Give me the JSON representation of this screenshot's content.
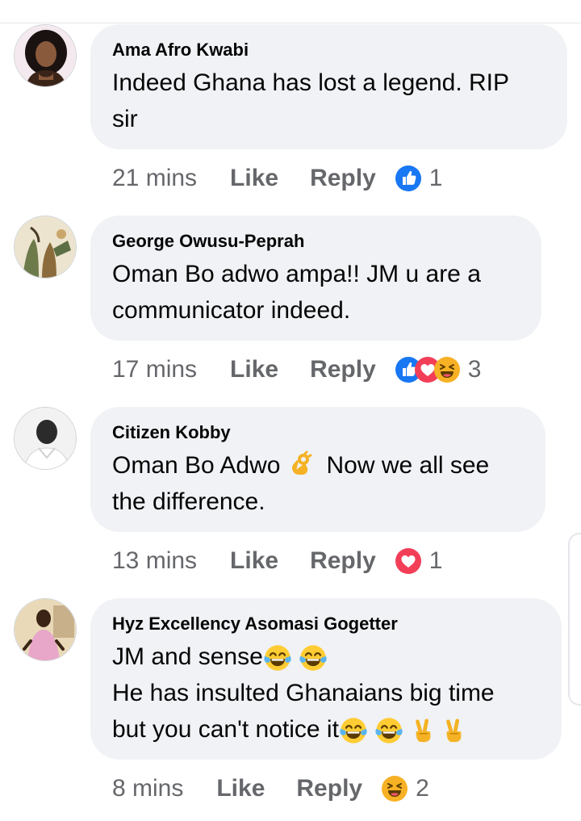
{
  "comments": [
    {
      "author": "Ama Afro Kwabi",
      "text_lines": [
        "Indeed Ghana has lost a legend. RIP",
        "sir"
      ],
      "time": "21 mins",
      "like_label": "Like",
      "reply_label": "Reply",
      "reactions": [
        "like-icon"
      ],
      "reaction_count": "1"
    },
    {
      "author": "George Owusu-Peprah",
      "text_lines": [
        "Oman Bo adwo ampa!! JM u are a",
        "communicator indeed."
      ],
      "time": "17 mins",
      "like_label": "Like",
      "reply_label": "Reply",
      "reactions": [
        "like-icon",
        "love-icon",
        "haha-icon"
      ],
      "reaction_count": "3"
    },
    {
      "author": "Citizen Kobby",
      "text_lines": [
        "Oman Bo Adwo",
        "Now we all see",
        "the difference."
      ],
      "emoji_inline": [
        "ok-hand-emoji"
      ],
      "time": "13 mins",
      "like_label": "Like",
      "reply_label": "Reply",
      "reactions": [
        "love-icon"
      ],
      "reaction_count": "1"
    },
    {
      "author": "Hyz Excellency Asomasi Gogetter",
      "text_lines": [
        "JM and sense",
        "He has insulted Ghanaians big time",
        "but you can't notice it"
      ],
      "emoji_inline": [
        "tears-of-joy-emoji",
        "victory-hand-emoji"
      ],
      "time": "8 mins",
      "like_label": "Like",
      "reply_label": "Reply",
      "reactions": [
        "haha-icon"
      ],
      "reaction_count": "2"
    }
  ],
  "colors": {
    "bubble": "#f0f2f5",
    "meta_text": "#65676b",
    "like_blue": "#1877f2",
    "love_red": "#f33e58",
    "haha_yellow": "#f7b125"
  }
}
